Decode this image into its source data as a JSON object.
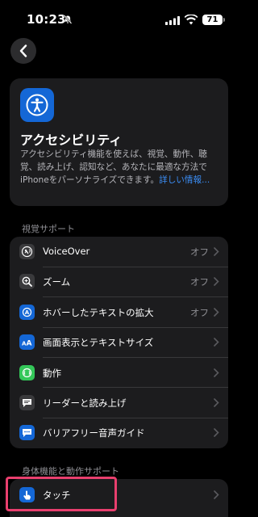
{
  "status": {
    "time": "10:23",
    "battery": "71"
  },
  "header": {
    "title": "アクセシビリティ",
    "description": "アクセシビリティ機能を使えば、視覚、動作、聴覚、読み上げ、認知など、あなたに最適な方法でiPhoneをパーソナライズできます。",
    "link": "詳しい情報..."
  },
  "vision": {
    "title": "視覚サポート",
    "items": [
      {
        "label": "VoiceOver",
        "value": "オフ",
        "icon": "voiceover-icon"
      },
      {
        "label": "ズーム",
        "value": "オフ",
        "icon": "zoom-icon"
      },
      {
        "label": "ホバーしたテキストの拡大",
        "value": "オフ",
        "icon": "hover-text-icon"
      },
      {
        "label": "画面表示とテキストサイズ",
        "value": "",
        "icon": "text-size-icon"
      },
      {
        "label": "動作",
        "value": "",
        "icon": "motion-icon"
      },
      {
        "label": "リーダーと読み上げ",
        "value": "",
        "icon": "spoken-content-icon"
      },
      {
        "label": "バリアフリー音声ガイド",
        "value": "",
        "icon": "audio-description-icon"
      }
    ]
  },
  "physical": {
    "title": "身体機能と動作サポート",
    "items": [
      {
        "label": "タッチ",
        "value": "",
        "icon": "touch-icon"
      }
    ]
  },
  "colors": {
    "accent": "#1467d6",
    "link": "#3b8ef6",
    "highlight": "#e93f6e"
  }
}
